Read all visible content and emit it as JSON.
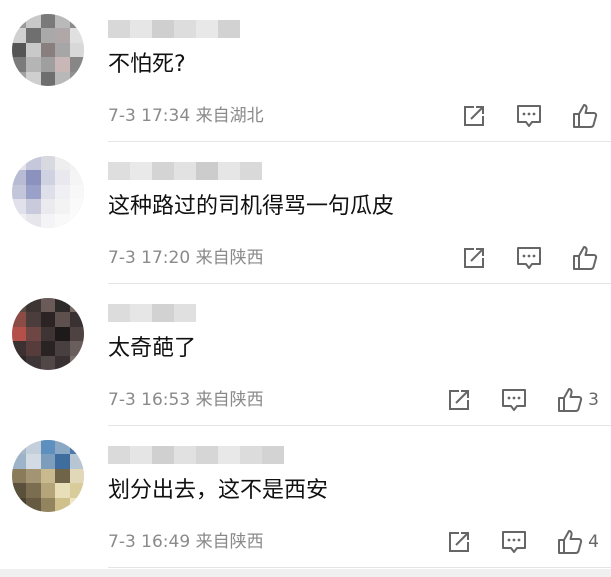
{
  "comments": [
    {
      "text": "不怕死?",
      "time": "7-3 17:34 来自湖北",
      "like_count": "",
      "avatar_colors": [
        "#9a9a9a",
        "#c8c8c8",
        "#7a7a7a",
        "#b9b9b9",
        "#8c8c8c",
        "#d0d0d0",
        "#6f6f6f",
        "#a9a9a9",
        "#b0a8a8",
        "#e0e0e0",
        "#555555",
        "#c9c9c9",
        "#8a7f7f",
        "#a6a6a6",
        "#d8d8d8",
        "#7b7b7b",
        "#b5b5b5",
        "#9f9f9f",
        "#c9b7b7",
        "#878787",
        "#a1a1a1",
        "#cfcfcf",
        "#6e6e6e",
        "#b8b8b8",
        "#919191"
      ],
      "name_colors": [
        "#d8d8d8",
        "#e6e6e6",
        "#cfcfcf",
        "#dddddd",
        "#e8e8e8",
        "#d2d2d2"
      ]
    },
    {
      "text": "这种路过的司机得骂一句瓜皮",
      "time": "7-3 17:20 来自陕西",
      "like_count": "",
      "avatar_colors": [
        "#e2e2e8",
        "#c5c8da",
        "#d8d8e0",
        "#eeeeee",
        "#f2f2f2",
        "#b7bbd4",
        "#8a92bd",
        "#cfd2e0",
        "#e8e8ee",
        "#f5f5f5",
        "#c3c6da",
        "#9aa1c8",
        "#dedfe8",
        "#f0f0f4",
        "#f8f8f8",
        "#e0e1ea",
        "#c9cbdc",
        "#ebebef",
        "#f3f3f3",
        "#fafafa",
        "#f0f0f3",
        "#e6e6ec",
        "#f4f4f6",
        "#f9f9f9",
        "#fbfbfb"
      ],
      "name_colors": [
        "#dedede",
        "#e9e9e9",
        "#d4d4d4",
        "#e2e2e2",
        "#cccccc",
        "#e6e6e6",
        "#d9d9d9"
      ]
    },
    {
      "text": "太奇葩了",
      "time": "7-3 16:53 来自陕西",
      "like_count": "3",
      "avatar_colors": [
        "#5a4a46",
        "#3c3534",
        "#6b5b58",
        "#2e2a29",
        "#7a6a66",
        "#8a4c44",
        "#4a3d3b",
        "#2c2424",
        "#5d504d",
        "#3a3232",
        "#b4504a",
        "#6e4744",
        "#3f3434",
        "#1e1a1a",
        "#4e4242",
        "#3b3131",
        "#563c3a",
        "#2a2323",
        "#484040",
        "#6a5e5c",
        "#2f2828",
        "#3e3636",
        "#514747",
        "#393131",
        "#7a706e"
      ],
      "name_colors": [
        "#dcdcdc",
        "#e6e6e6",
        "#d2d2d2",
        "#e0e0e0"
      ]
    },
    {
      "text": "划分出去，这不是西安",
      "time": "7-3 16:49 来自陕西",
      "like_count": "4",
      "avatar_colors": [
        "#aab8c8",
        "#c3d0dc",
        "#5d8fbf",
        "#8aa7c4",
        "#4b7aa8",
        "#9db3c8",
        "#d2dbe4",
        "#7d9dbd",
        "#3f6e9e",
        "#b8c6d4",
        "#8a7b5a",
        "#a39474",
        "#c9b98e",
        "#6f6348",
        "#e0d8b8",
        "#5b503c",
        "#7b6d4f",
        "#b6a47a",
        "#e8dfb8",
        "#d8cc9a",
        "#4a4233",
        "#665a42",
        "#938460",
        "#cfc08c",
        "#efe7c4"
      ],
      "name_colors": [
        "#dadada",
        "#e5e5e5",
        "#d0d0d0",
        "#e1e1e1",
        "#d6d6d6",
        "#e8e8e8",
        "#dcdcdc",
        "#d3d3d3"
      ]
    }
  ],
  "icons": {
    "share": "share-icon",
    "comment": "comment-icon",
    "like": "thumbs-up-icon"
  },
  "colors": {
    "text": "#111111",
    "meta": "#8a8a8a",
    "icon": "#666666",
    "divider": "#e5e5e5"
  }
}
